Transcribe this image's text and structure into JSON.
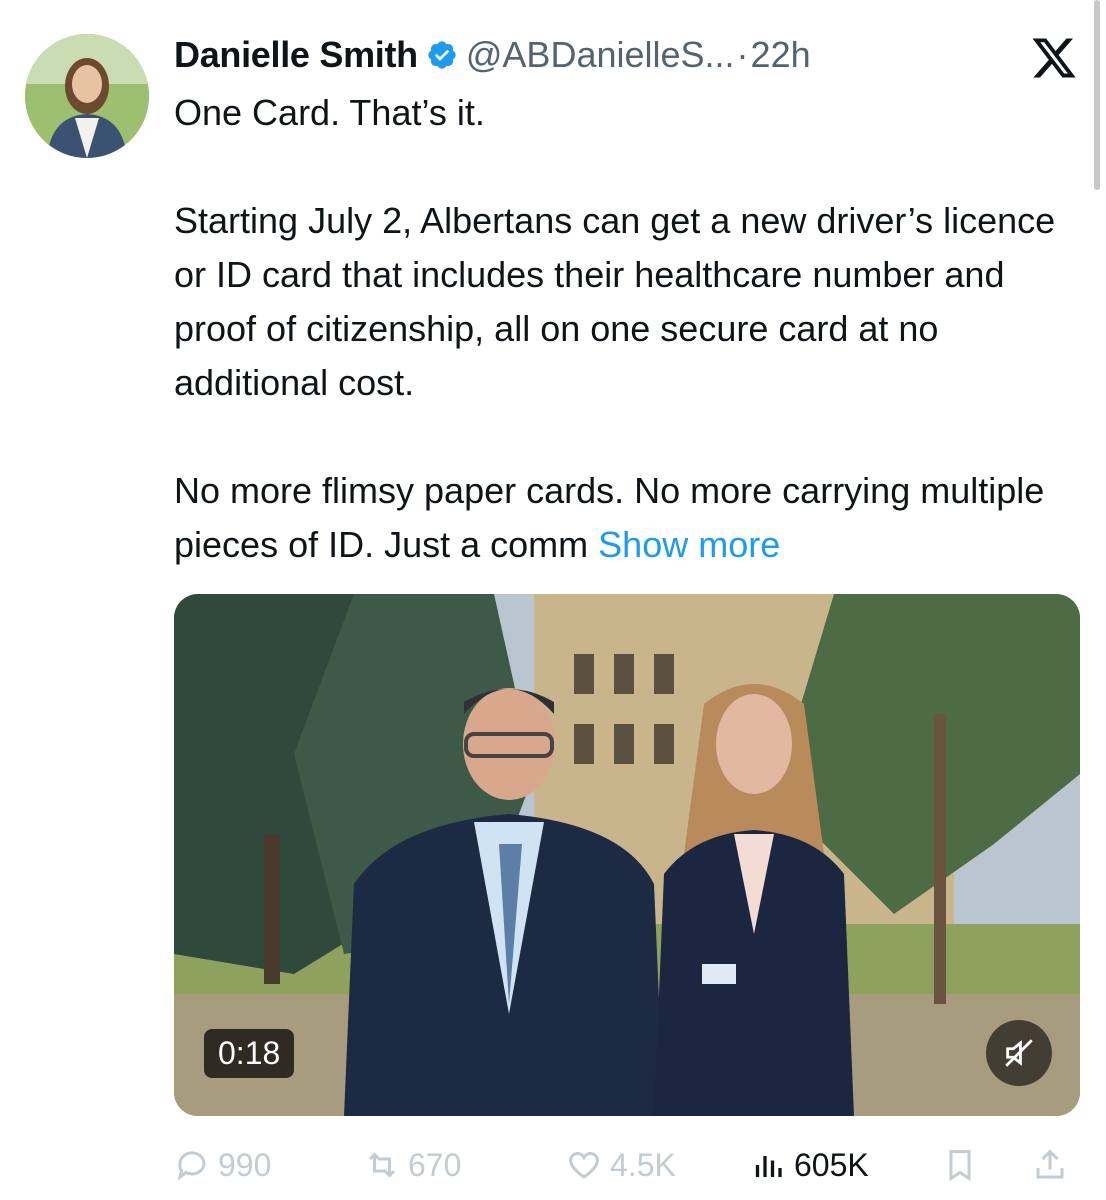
{
  "author": {
    "name": "Danielle Smith",
    "handle": "@ABDanielleS...",
    "separator": "·",
    "time": "22h"
  },
  "icons": {
    "verified": "verified-badge-icon",
    "platform": "x-logo-icon",
    "mute": "muted-speaker-icon",
    "reply": "comment-icon",
    "retweet": "retweet-icon",
    "like": "heart-icon",
    "views": "bar-chart-icon",
    "bookmark": "bookmark-icon",
    "share": "share-icon"
  },
  "colors": {
    "accent": "#1d9bf0",
    "text": "#0f1419",
    "muted": "#536471",
    "faded_actions": "#c4ccd3"
  },
  "tweet": {
    "line1": "One Card. That’s it.",
    "para2": "Starting July 2, Albertans can get a new driver’s licence or ID card that includes their healthcare number and proof of citizenship, all on one secure card at no additional cost.",
    "para3": "No more flimsy paper cards. No more carrying multiple pieces of ID. Just a comm",
    "show_more": "Show more"
  },
  "media": {
    "duration": "0:18"
  },
  "stats": {
    "replies": "990",
    "retweets": "670",
    "likes": "4.5K",
    "views": "605K"
  }
}
